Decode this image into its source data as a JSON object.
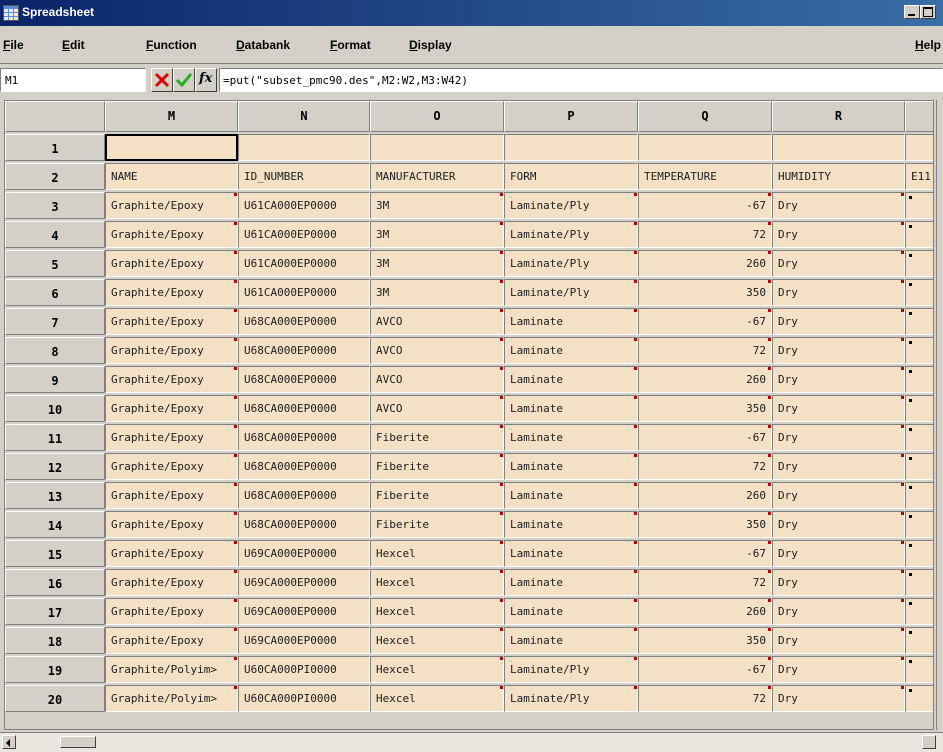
{
  "window": {
    "title": "Spreadsheet"
  },
  "menu": [
    {
      "id": "file",
      "label": "File"
    },
    {
      "id": "edit",
      "label": "Edit"
    },
    {
      "id": "function",
      "label": "Function"
    },
    {
      "id": "databank",
      "label": "Databank"
    },
    {
      "id": "format",
      "label": "Format"
    },
    {
      "id": "display",
      "label": "Display"
    },
    {
      "id": "help",
      "label": "Help"
    }
  ],
  "formula_bar": {
    "cell_reference": "M1",
    "formula": "=put(\"subset_pmc90.des\",M2:W2,M3:W42)",
    "fx_label": "fx"
  },
  "grid": {
    "columns": [
      "M",
      "N",
      "O",
      "P",
      "Q",
      "R"
    ],
    "partial_column_label": "",
    "rows": [
      {
        "num": "1",
        "cells": [
          "",
          "",
          "",
          "",
          "",
          ""
        ],
        "extra": ""
      },
      {
        "num": "2",
        "cells": [
          "NAME",
          "ID_NUMBER",
          "MANUFACTURER",
          "FORM",
          "TEMPERATURE",
          "HUMIDITY"
        ],
        "extra": "E11"
      },
      {
        "num": "3",
        "cells": [
          "Graphite/Epoxy",
          "U61CA000EP0000",
          "3M",
          "Laminate/Ply",
          "-67",
          "Dry"
        ],
        "extra": ""
      },
      {
        "num": "4",
        "cells": [
          "Graphite/Epoxy",
          "U61CA000EP0000",
          "3M",
          "Laminate/Ply",
          "72",
          "Dry"
        ],
        "extra": ""
      },
      {
        "num": "5",
        "cells": [
          "Graphite/Epoxy",
          "U61CA000EP0000",
          "3M",
          "Laminate/Ply",
          "260",
          "Dry"
        ],
        "extra": ""
      },
      {
        "num": "6",
        "cells": [
          "Graphite/Epoxy",
          "U61CA000EP0000",
          "3M",
          "Laminate/Ply",
          "350",
          "Dry"
        ],
        "extra": ""
      },
      {
        "num": "7",
        "cells": [
          "Graphite/Epoxy",
          "U68CA000EP0000",
          "AVCO",
          "Laminate",
          "-67",
          "Dry"
        ],
        "extra": ""
      },
      {
        "num": "8",
        "cells": [
          "Graphite/Epoxy",
          "U68CA000EP0000",
          "AVCO",
          "Laminate",
          "72",
          "Dry"
        ],
        "extra": ""
      },
      {
        "num": "9",
        "cells": [
          "Graphite/Epoxy",
          "U68CA000EP0000",
          "AVCO",
          "Laminate",
          "260",
          "Dry"
        ],
        "extra": ""
      },
      {
        "num": "10",
        "cells": [
          "Graphite/Epoxy",
          "U68CA000EP0000",
          "AVCO",
          "Laminate",
          "350",
          "Dry"
        ],
        "extra": ""
      },
      {
        "num": "11",
        "cells": [
          "Graphite/Epoxy",
          "U68CA000EP0000",
          "Fiberite",
          "Laminate",
          "-67",
          "Dry"
        ],
        "extra": ""
      },
      {
        "num": "12",
        "cells": [
          "Graphite/Epoxy",
          "U68CA000EP0000",
          "Fiberite",
          "Laminate",
          "72",
          "Dry"
        ],
        "extra": ""
      },
      {
        "num": "13",
        "cells": [
          "Graphite/Epoxy",
          "U68CA000EP0000",
          "Fiberite",
          "Laminate",
          "260",
          "Dry"
        ],
        "extra": ""
      },
      {
        "num": "14",
        "cells": [
          "Graphite/Epoxy",
          "U68CA000EP0000",
          "Fiberite",
          "Laminate",
          "350",
          "Dry"
        ],
        "extra": ""
      },
      {
        "num": "15",
        "cells": [
          "Graphite/Epoxy",
          "U69CA000EP0000",
          "Hexcel",
          "Laminate",
          "-67",
          "Dry"
        ],
        "extra": ""
      },
      {
        "num": "16",
        "cells": [
          "Graphite/Epoxy",
          "U69CA000EP0000",
          "Hexcel",
          "Laminate",
          "72",
          "Dry"
        ],
        "extra": ""
      },
      {
        "num": "17",
        "cells": [
          "Graphite/Epoxy",
          "U69CA000EP0000",
          "Hexcel",
          "Laminate",
          "260",
          "Dry"
        ],
        "extra": ""
      },
      {
        "num": "18",
        "cells": [
          "Graphite/Epoxy",
          "U69CA000EP0000",
          "Hexcel",
          "Laminate",
          "350",
          "Dry"
        ],
        "extra": ""
      },
      {
        "num": "19",
        "cells": [
          "Graphite/Polyim>",
          "U60CA000PI0000",
          "Hexcel",
          "Laminate/Ply",
          "-67",
          "Dry"
        ],
        "extra": ""
      },
      {
        "num": "20",
        "cells": [
          "Graphite/Polyim>",
          "U60CA000PI0000",
          "Hexcel",
          "Laminate/Ply",
          "72",
          "Dry"
        ],
        "extra": ""
      }
    ]
  },
  "colors": {
    "cell_bg": "#f3e0c5",
    "chrome": "#d4d0c8",
    "titlebar": "#0a246a",
    "flag": "#c00000"
  }
}
